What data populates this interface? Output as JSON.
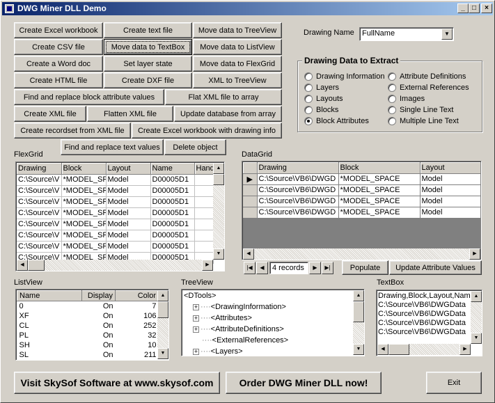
{
  "window": {
    "title": "DWG Miner DLL Demo",
    "controls": [
      "_",
      "□",
      "×"
    ]
  },
  "buttons": {
    "create_excel_workbook": "Create Excel workbook",
    "create_text_file": "Create text file",
    "move_to_treeview": "Move data to TreeView",
    "create_csv_file": "Create CSV file",
    "move_to_textbox": "Move data to TextBox",
    "move_to_listview": "Move data to ListView",
    "create_word_doc": "Create a Word doc",
    "set_layer_state": "Set layer state",
    "move_to_flexgrid": "Move data to FlexGrid",
    "create_html_file": "Create HTML file",
    "create_dxf_file": "Create DXF file",
    "xml_to_treeview": "XML to TreeView",
    "find_replace_block_attr": "Find and replace block attribute values",
    "flat_xml_to_array": "Flat XML file to array",
    "create_xml_file": "Create XML file",
    "flatten_xml_file": "Flatten XML file",
    "update_database_from_array": "Update database from array",
    "create_recordset_from_xml": "Create recordset from XML file",
    "create_excel_with_drawing_info": "Create Excel workbook with drawing info",
    "find_replace_text_values": "Find and replace text values",
    "delete_object": "Delete object",
    "populate": "Populate",
    "update_attribute_values": "Update Attribute Values",
    "visit_skysof": "Visit SkySof Software at www.skysof.com",
    "order_dwg_miner": "Order DWG Miner DLL now!",
    "exit": "Exit"
  },
  "drawing_name": {
    "label": "Drawing Name",
    "value": "FullName"
  },
  "extract_group": {
    "title": "Drawing Data to Extract",
    "left_options": [
      "Drawing Information",
      "Layers",
      "Layouts",
      "Blocks",
      "Block Attributes"
    ],
    "right_options": [
      "Attribute Definitions",
      "External References",
      "Images",
      "Single Line Text",
      "Multiple Line Text"
    ],
    "selected": "Block Attributes"
  },
  "flexgrid": {
    "label": "FlexGrid",
    "columns": [
      "Drawing",
      "Block",
      "Layout",
      "Name",
      "Hand"
    ],
    "rows": [
      [
        "C:\\Source\\V",
        "*MODEL_SP",
        "Model",
        "D00005D1",
        ""
      ],
      [
        "C:\\Source\\V",
        "*MODEL_SP",
        "Model",
        "D00005D1",
        ""
      ],
      [
        "C:\\Source\\V",
        "*MODEL_SP",
        "Model",
        "D00005D1",
        ""
      ],
      [
        "C:\\Source\\V",
        "*MODEL_SP",
        "Model",
        "D00005D1",
        ""
      ],
      [
        "C:\\Source\\V",
        "*MODEL_SP",
        "Model",
        "D00005D1",
        ""
      ],
      [
        "C:\\Source\\V",
        "*MODEL_SP",
        "Model",
        "D00005D1",
        ""
      ],
      [
        "C:\\Source\\V",
        "*MODEL_SP",
        "Model",
        "D00005D1",
        ""
      ],
      [
        "C:\\Source\\V",
        "*MODEL_SP",
        "Model",
        "D00005D1",
        ""
      ]
    ]
  },
  "datagrid": {
    "label": "DataGrid",
    "columns": [
      "Drawing",
      "Block",
      "Layout"
    ],
    "rows": [
      [
        "C:\\Source\\VB6\\DWGD",
        "*MODEL_SPACE",
        "Model"
      ],
      [
        "C:\\Source\\VB6\\DWGD",
        "*MODEL_SPACE",
        "Model"
      ],
      [
        "C:\\Source\\VB6\\DWGD",
        "*MODEL_SPACE",
        "Model"
      ],
      [
        "C:\\Source\\VB6\\DWGD",
        "*MODEL_SPACE",
        "Model"
      ]
    ],
    "record_count": "4 records"
  },
  "listview": {
    "label": "ListView",
    "columns": [
      "Name",
      "Display",
      "Color"
    ],
    "rows": [
      [
        "0",
        "On",
        "7"
      ],
      [
        "XF",
        "On",
        "106"
      ],
      [
        "CL",
        "On",
        "252"
      ],
      [
        "PL",
        "On",
        "32"
      ],
      [
        "SH",
        "On",
        "10"
      ],
      [
        "SL",
        "On",
        "211"
      ]
    ]
  },
  "treeview": {
    "label": "TreeView",
    "root": "<DTools>",
    "items": [
      "<DrawingInformation>",
      "<Attributes>",
      "<AttributeDefinitions>",
      "<ExternalReferences>",
      "<Layers>"
    ]
  },
  "textbox": {
    "label": "TextBox",
    "lines": [
      "Drawing,Block,Layout,Name",
      "C:\\Source\\VB6\\DWGData",
      "C:\\Source\\VB6\\DWGData",
      "C:\\Source\\VB6\\DWGData",
      "C:\\Source\\VB6\\DWGData"
    ]
  }
}
